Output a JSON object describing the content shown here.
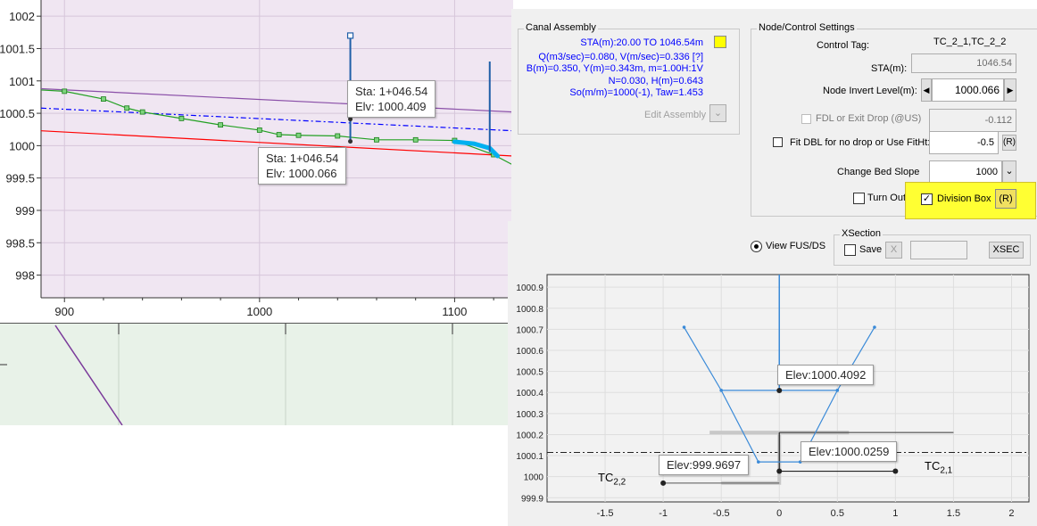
{
  "profile_chart": {
    "y_ticks": [
      "1002",
      "1001.5",
      "1001",
      "1000.5",
      "1000",
      "999.5",
      "999",
      "998.5",
      "998"
    ],
    "x_ticks": [
      "900",
      "1000",
      "1100"
    ],
    "tooltip_upper": {
      "sta": "Sta: 1+046.54",
      "elv": "Elv: 1000.409"
    },
    "tooltip_lower": {
      "sta": "Sta: 1+046.54",
      "elv": "Elv: 1000.066"
    }
  },
  "chart_data": [
    {
      "type": "line",
      "name": "profile",
      "xlim": [
        888,
        1130
      ],
      "ylim": [
        997.65,
        1002.25
      ],
      "series": [
        {
          "name": "",
          "color": "#8a4fa8",
          "x": [
            888,
            1130
          ],
          "y": [
            1000.88,
            1000.52
          ]
        },
        {
          "name": "",
          "color": "#0000ff",
          "dash": true,
          "x": [
            888,
            1130
          ],
          "y": [
            1000.58,
            1000.23
          ]
        },
        {
          "name": "",
          "color": "#ff0000",
          "x": [
            888,
            1130
          ],
          "y": [
            1000.23,
            999.84
          ]
        },
        {
          "name": "",
          "color": "#22a022",
          "x": [
            888,
            900,
            920,
            932,
            940,
            960,
            980,
            1000,
            1010,
            1020,
            1040,
            1046.54,
            1060,
            1080,
            1100,
            1120,
            1130
          ],
          "y": [
            1000.86,
            1000.84,
            1000.72,
            1000.58,
            1000.52,
            1000.42,
            1000.32,
            1000.24,
            1000.17,
            1000.16,
            1000.15,
            1000.13,
            1000.09,
            1000.09,
            1000.08,
            999.86,
            999.7
          ]
        }
      ],
      "vlines": [
        {
          "x": 1046.54,
          "y0": 1000.066,
          "y1": 1001.7,
          "color": "#1f5fa8"
        },
        {
          "x": 1118,
          "y0": 999.9,
          "y1": 1001.3,
          "color": "#1f5fa8"
        }
      ],
      "highlight": {
        "color": "#00b0f0",
        "x": [
          1100,
          1110,
          1118,
          1122
        ],
        "y": [
          1000.06,
          1000.03,
          999.96,
          999.84
        ]
      }
    },
    {
      "type": "line",
      "name": "xsection",
      "xlim": [
        -2.0,
        2.15
      ],
      "ylim": [
        999.88,
        1000.96
      ],
      "x_ticks": [
        -1.5,
        -1,
        -0.5,
        0,
        0.5,
        1,
        1.5,
        2
      ],
      "y_ticks": [
        999.9,
        1000,
        1000.1,
        1000.2,
        1000.3,
        1000.4,
        1000.5,
        1000.6,
        1000.7,
        1000.8,
        1000.9
      ],
      "series": [
        {
          "name": "",
          "color": "#3a8ad8",
          "x": [
            -0.82,
            -0.5,
            -0.18,
            0.18,
            0.5,
            0.82
          ],
          "y": [
            1000.71,
            1000.41,
            1000.07,
            1000.07,
            1000.41,
            1000.71
          ]
        }
      ],
      "water_surface": 1000.115,
      "points": [
        {
          "x": 0,
          "y": 1000.4092
        },
        {
          "x": 0,
          "y": 1000.0259
        },
        {
          "x": -1,
          "y": 999.9697
        },
        {
          "x": 1,
          "y": 1000.0259
        }
      ]
    }
  ],
  "canal_assembly": {
    "title": "Canal Assembly",
    "lines": [
      "STA(m):20.00 TO 1046.54m",
      "Q(m3/sec)=0.080, V(m/sec)=0.336 [?]",
      "B(m)=0.350,  Y(m)=0.343m, m=1.00H:1V",
      "N=0.030, H(m)=0.643",
      "So(m/m)=1000(-1),  Taw=1.453"
    ],
    "color_swatch": "#ffff00",
    "edit_label": "Edit Assembly"
  },
  "node_settings": {
    "title": "Node/Control Settings",
    "control_tag_label": "Control Tag:",
    "control_tag_value": "TC_2_1,TC_2_2",
    "sta_label": "STA(m):",
    "sta_value": "1046.54",
    "invert_label": "Node Invert Level(m):",
    "invert_value": "1000.066",
    "fdl_label": "FDL or Exit Drop (@US)",
    "fdl_value": "-0.112",
    "fit_label": "Fit DBL for no drop or Use FitHt:",
    "fit_value": "-0.5",
    "fit_r": "(R)",
    "bed_label": "Change Bed Slope",
    "bed_value": "1000",
    "turnout_label": "Turn Out",
    "division_label": "Division Box",
    "division_r": "(R)"
  },
  "view_fus_label": "View FUS/DS",
  "xsection_group": {
    "title": "XSection",
    "save_label": "Save",
    "x_label": "X",
    "xsec_label": "XSEC"
  },
  "xsection_chart": {
    "y_ticks": [
      "1000.9",
      "1000.8",
      "1000.7",
      "1000.6",
      "1000.5",
      "1000.4",
      "1000.3",
      "1000.2",
      "1000.1",
      "1000",
      "999.9"
    ],
    "x_ticks": [
      "-1.5",
      "-1",
      "-0.5",
      "0",
      "0.5",
      "1",
      "1.5",
      "2"
    ],
    "tip_top": "Elev:1000.4092",
    "tip_mid": "Elev:1000.0259",
    "tip_left": "Elev:999.9697",
    "tc22": "TC",
    "tc22_sub": "2,2",
    "tc21": "TC",
    "tc21_sub": "2,1"
  },
  "colors": {
    "plot_bg": "#f0e6f2",
    "lower_bg": "#e8f2e8",
    "highlight": "#ffff33"
  }
}
